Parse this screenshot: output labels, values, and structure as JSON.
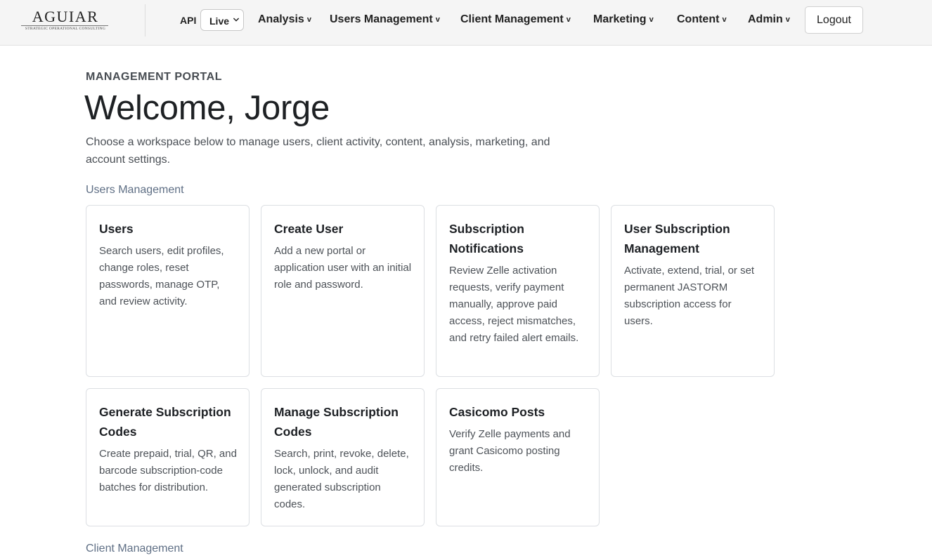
{
  "logo": {
    "name": "AGUIAR",
    "tagline": "STRATEGIC OPERATIONAL CONSULTING"
  },
  "nav": {
    "api_label": "API",
    "api_env": {
      "selected": "Live"
    },
    "items": [
      {
        "label": "Analysis",
        "caret": "v"
      },
      {
        "label": "Users Management",
        "caret": "v"
      },
      {
        "label": "Client Management",
        "caret": "v"
      },
      {
        "label": "Marketing",
        "caret": "v"
      },
      {
        "label": "Content",
        "caret": "v"
      },
      {
        "label": "Admin",
        "caret": "v"
      }
    ],
    "logout_label": "Logout"
  },
  "hero": {
    "eyebrow": "MANAGEMENT PORTAL",
    "title": "Welcome, Jorge",
    "lede": "Choose a workspace below to manage users, client activity, content, analysis, marketing, and account settings."
  },
  "sections": [
    {
      "title": "Users Management",
      "cards": [
        {
          "title": "Users",
          "desc": "Search users, edit profiles, change roles, reset passwords, manage OTP, and review activity."
        },
        {
          "title": "Create User",
          "desc": "Add a new portal or application user with an initial role and password."
        },
        {
          "title": "Subscription Notifications",
          "desc": "Review Zelle activation requests, verify payment manually, approve paid access, reject mismatches, and retry failed alert emails."
        },
        {
          "title": "User Subscription Management",
          "desc": "Activate, extend, trial, or set permanent JASTORM subscription access for users."
        },
        {
          "title": "Generate Subscription Codes",
          "desc": "Create prepaid, trial, QR, and barcode subscription-code batches for distribution."
        },
        {
          "title": "Manage Subscription Codes",
          "desc": "Search, print, revoke, delete, lock, unlock, and audit generated subscription codes."
        },
        {
          "title": "Casicomo Posts",
          "desc": "Verify Zelle payments and grant Casicomo posting credits."
        }
      ]
    },
    {
      "title": "Client Management",
      "cards": []
    }
  ],
  "colors": {
    "nav_bg": "#f5f5f5",
    "heading": "#1e2124",
    "section_title": "#5f6f85",
    "card_border": "#dcdfe3"
  },
  "icons": {
    "api_select": "chevron-down-icon"
  }
}
